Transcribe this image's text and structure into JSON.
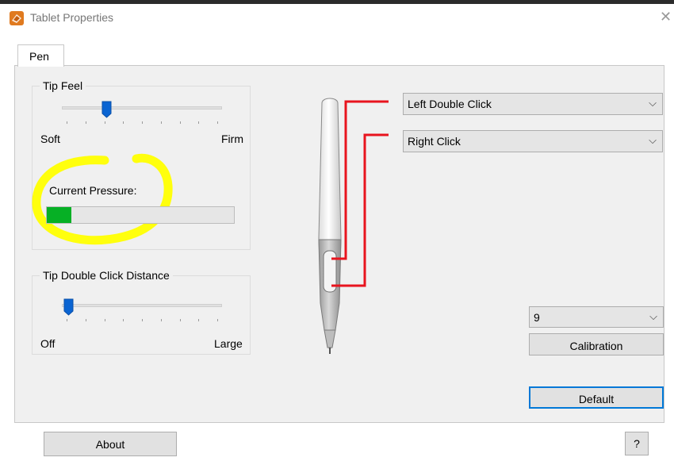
{
  "window": {
    "title": "Tablet Properties",
    "close_icon": "close-icon"
  },
  "tabs": [
    {
      "label": "Pen",
      "selected": true
    }
  ],
  "tip_feel": {
    "group_title": "Tip Feel",
    "min_label": "Soft",
    "max_label": "Firm",
    "value_fraction": 0.26
  },
  "current_pressure": {
    "label": "Current Pressure:",
    "level_fraction": 0.13,
    "fill_color": "#06b025",
    "highlight_color": "#ffff00"
  },
  "tip_double_click": {
    "group_title": "Tip Double Click Distance",
    "min_label": "Off",
    "max_label": "Large",
    "value_fraction": 0.0
  },
  "pen_buttons": {
    "upper_button_action": "Left Double Click",
    "lower_button_action": "Right Click",
    "connector_color": "#e8141e"
  },
  "calibration": {
    "port_value": "9",
    "button_label": "Calibration"
  },
  "buttons": {
    "default_label": "Default",
    "about_label": "About",
    "help_label": "?"
  }
}
